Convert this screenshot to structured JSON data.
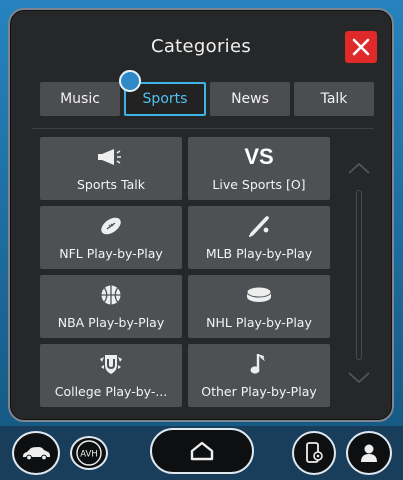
{
  "dialog": {
    "title": "Categories",
    "close_label": "close"
  },
  "tabs": [
    {
      "label": "Music",
      "active": false
    },
    {
      "label": "Sports",
      "active": true
    },
    {
      "label": "News",
      "active": false
    },
    {
      "label": "Talk",
      "active": false
    }
  ],
  "tiles": [
    {
      "label": "Sports Talk",
      "icon": "megaphone-icon"
    },
    {
      "label": "Live Sports [O]",
      "icon": "vs-icon",
      "icon_text": "VS"
    },
    {
      "label": "NFL Play-by-Play",
      "icon": "football-icon"
    },
    {
      "label": "MLB Play-by-Play",
      "icon": "baseball-bat-icon"
    },
    {
      "label": "NBA Play-by-Play",
      "icon": "basketball-icon"
    },
    {
      "label": "NHL Play-by-Play",
      "icon": "hockey-puck-icon"
    },
    {
      "label": "College Play-by-...",
      "icon": "college-shield-icon"
    },
    {
      "label": "Other Play-by-Play",
      "icon": "music-note-icon"
    }
  ],
  "bottom_bar": {
    "avh_label": "AVH"
  },
  "colors": {
    "accent": "#3fb2e6",
    "close": "#e02a2a",
    "tile": "#4e5154",
    "panel": "#262729"
  }
}
